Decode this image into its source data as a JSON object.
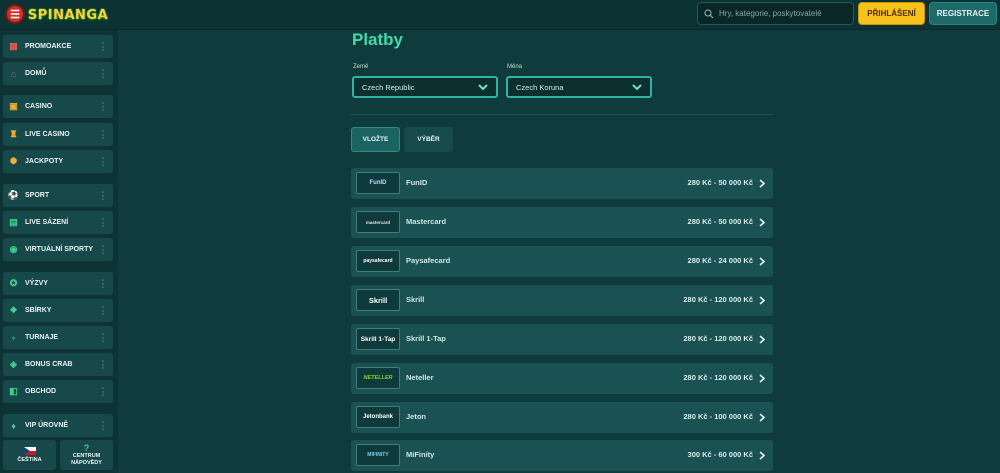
{
  "header": {
    "logo_text": "SPINANGA",
    "search_placeholder": "Hry, kategorie, poskytovatelé",
    "login_label": "PŘIHLÁŠENÍ",
    "register_label": "REGISTRACE"
  },
  "sidebar": {
    "items": [
      {
        "label": "PROMOAKCE",
        "icon": "gift-icon"
      },
      {
        "label": "DOMŮ",
        "icon": "home-icon"
      },
      {
        "label": "CASINO",
        "icon": "casino-chest-icon"
      },
      {
        "label": "LIVE CASINO",
        "icon": "bell-icon"
      },
      {
        "label": "JACKPOTY",
        "icon": "jackpot-coin-icon"
      },
      {
        "label": "SPORT",
        "icon": "soccer-ball-icon"
      },
      {
        "label": "LIVE SÁZENÍ",
        "icon": "live-betting-icon"
      },
      {
        "label": "VIRTUÁLNÍ SPORTY",
        "icon": "virtual-sports-icon"
      },
      {
        "label": "VÝZVY",
        "icon": "challenge-icon"
      },
      {
        "label": "SBÍRKY",
        "icon": "collection-icon"
      },
      {
        "label": "TURNAJE",
        "icon": "trophy-icon"
      },
      {
        "label": "BONUS CRAB",
        "icon": "crab-icon"
      },
      {
        "label": "OBCHOD",
        "icon": "shop-icon"
      },
      {
        "label": "VIP ÚROVNĚ",
        "icon": "diamond-icon"
      }
    ],
    "language_label": "ČEŠTINA",
    "help_label_1": "CENTRUM",
    "help_label_2": "NÁPOVĚDY"
  },
  "main": {
    "title": "Platby",
    "country_label": "Země",
    "country_value": "Czech Republic",
    "currency_label": "Měna",
    "currency_value": "Czech Koruna",
    "tabs": [
      {
        "label": "VLOŽTE",
        "active": true
      },
      {
        "label": "VÝBĚR",
        "active": false
      }
    ],
    "methods": [
      {
        "name": "FunID",
        "logo": "FunID",
        "range": "280 Kč - 50 000 Kč"
      },
      {
        "name": "Mastercard",
        "logo": "mastercard",
        "range": "280 Kč - 50 000 Kč"
      },
      {
        "name": "Paysafecard",
        "logo": "paysafecard",
        "range": "280 Kč - 24 000 Kč"
      },
      {
        "name": "Skrill",
        "logo": "Skrill",
        "range": "280 Kč - 120 000 Kč"
      },
      {
        "name": "Skrill 1-Tap",
        "logo": "Skrill 1-Tap",
        "range": "280 Kč - 120 000 Kč"
      },
      {
        "name": "Neteller",
        "logo": "NETELLER",
        "range": "280 Kč - 120 000 Kč"
      },
      {
        "name": "Jeton",
        "logo": "Jetonbank",
        "range": "280 Kč - 100 000 Kč"
      },
      {
        "name": "MiFinity",
        "logo": "MIFINITY",
        "range": "300 Kč - 60 000 Kč"
      }
    ]
  },
  "colors": {
    "background": "#0f3b3c",
    "accent_title": "#43d9a8",
    "login_yellow": "#f7c21a",
    "select_border": "#2eb3a4"
  }
}
